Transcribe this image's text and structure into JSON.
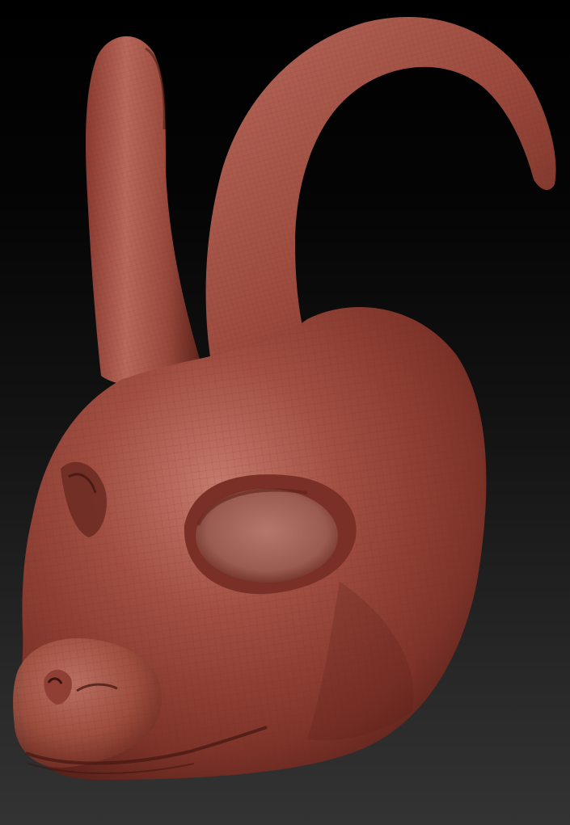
{
  "viewport": {
    "background_top": "#000000",
    "background_bottom": "#333333"
  },
  "model": {
    "subject": "sculpted-horned-creature-head",
    "material_base": "#8f3f33",
    "material_highlight": "#c47a6c",
    "material_shadow": "#4a1a14",
    "wireframe_color": "#5a241c",
    "features": [
      "left-horn",
      "right-horn-curved",
      "head",
      "eye-socket",
      "nose",
      "mouth"
    ]
  }
}
